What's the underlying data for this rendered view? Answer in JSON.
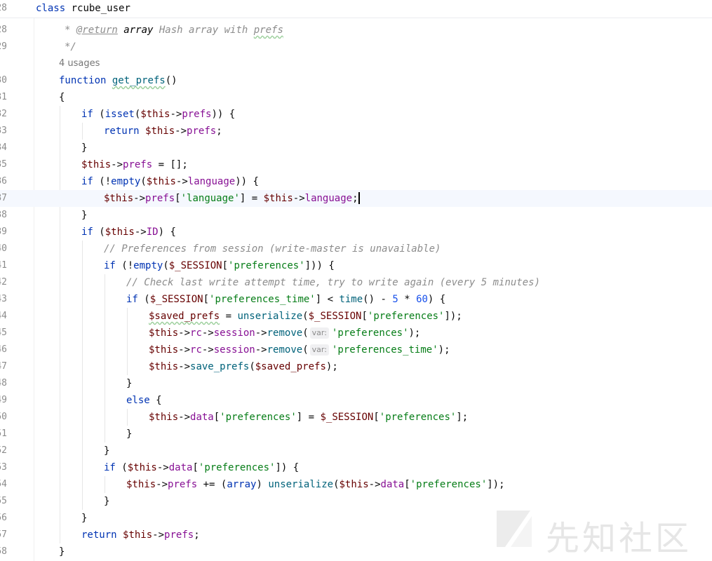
{
  "header": {
    "line_number": "28",
    "kw": "class",
    "name": "rcube_user"
  },
  "editor": {
    "l28": {
      "ln": "28",
      "prefix": "* ",
      "tag": "@return",
      "type": " array",
      "rest": " Hash array with ",
      "typo": "prefs"
    },
    "l29": {
      "ln": "29",
      "text": "*/"
    },
    "usages": "4 usages",
    "l30": {
      "ln": "30",
      "kw": "function",
      "sp": " ",
      "fn": "get_prefs",
      "rest": "()"
    },
    "l31": {
      "ln": "31",
      "text": "{"
    },
    "l32": {
      "ln": "32",
      "kw": "if",
      "t1": " (",
      "fn": "isset",
      "t2": "(",
      "this": "$this",
      "arrow": "->",
      "prop": "prefs",
      "t3": ")) {"
    },
    "l33": {
      "ln": "33",
      "kw": "return",
      "sp": " ",
      "this": "$this",
      "arrow": "->",
      "prop": "prefs",
      "t1": ";"
    },
    "l34": {
      "ln": "34",
      "text": "}"
    },
    "l35": {
      "ln": "35",
      "this": "$this",
      "arrow": "->",
      "prop": "prefs",
      "t1": " = [];"
    },
    "l36": {
      "ln": "36",
      "kw": "if",
      "t1": " (!",
      "fn": "empty",
      "t2": "(",
      "this": "$this",
      "arrow": "->",
      "prop": "language",
      "t3": ")) {"
    },
    "l37": {
      "ln": "37",
      "this1": "$this",
      "arrow1": "->",
      "prop1": "prefs",
      "t1": "[",
      "str": "'language'",
      "t2": "] = ",
      "this2": "$this",
      "arrow2": "->",
      "prop2": "language",
      "t3": ";"
    },
    "l38": {
      "ln": "38",
      "text": "}"
    },
    "l39": {
      "ln": "39",
      "kw": "if",
      "t1": " (",
      "this": "$this",
      "arrow": "->",
      "prop": "ID",
      "t2": ") {"
    },
    "l40": {
      "ln": "40",
      "comment": "// Preferences from session (write-master is unavailable)"
    },
    "l41": {
      "ln": "41",
      "kw": "if",
      "t1": " (!",
      "fn": "empty",
      "t2": "(",
      "sess": "$_SESSION",
      "t3": "[",
      "str": "'preferences'",
      "t4": "])) {"
    },
    "l42": {
      "ln": "42",
      "comment": "// Check last write attempt time, try to write again (every 5 minutes)"
    },
    "l43": {
      "ln": "43",
      "kw": "if",
      "t1": " (",
      "sess": "$_SESSION",
      "t2": "[",
      "str": "'preferences_time'",
      "t3": "] < ",
      "fn": "time",
      "t4": "() - ",
      "n1": "5",
      "t5": " * ",
      "n2": "60",
      "t6": ") {"
    },
    "l44": {
      "ln": "44",
      "var": "$saved_prefs",
      "t1": " = ",
      "fn": "unserialize",
      "t2": "(",
      "sess": "$_SESSION",
      "t3": "[",
      "str": "'preferences'",
      "t4": "]);"
    },
    "l45": {
      "ln": "45",
      "this": "$this",
      "a1": "->",
      "p1": "rc",
      "a2": "->",
      "p2": "session",
      "a3": "->",
      "fn": "remove",
      "t1": "(",
      "hint": "var:",
      "str": "'preferences'",
      "t2": ");"
    },
    "l46": {
      "ln": "46",
      "this": "$this",
      "a1": "->",
      "p1": "rc",
      "a2": "->",
      "p2": "session",
      "a3": "->",
      "fn": "remove",
      "t1": "(",
      "hint": "var:",
      "str": "'preferences_time'",
      "t2": ");"
    },
    "l47": {
      "ln": "47",
      "this": "$this",
      "a1": "->",
      "fn": "save_prefs",
      "t1": "(",
      "var": "$saved_prefs",
      "t2": ");"
    },
    "l48": {
      "ln": "48",
      "text": "}"
    },
    "l49": {
      "ln": "49",
      "kw": "else",
      "t1": " {"
    },
    "l50": {
      "ln": "50",
      "this": "$this",
      "arrow": "->",
      "prop": "data",
      "t1": "[",
      "str1": "'preferences'",
      "t2": "] = ",
      "sess": "$_SESSION",
      "t3": "[",
      "str2": "'preferences'",
      "t4": "];"
    },
    "l51": {
      "ln": "51",
      "text": "}"
    },
    "l52": {
      "ln": "52",
      "text": "}"
    },
    "l53": {
      "ln": "53",
      "kw": "if",
      "t1": " (",
      "this": "$this",
      "arrow": "->",
      "prop": "data",
      "t2": "[",
      "str": "'preferences'",
      "t3": "]) {"
    },
    "l54": {
      "ln": "54",
      "this1": "$this",
      "arrow1": "->",
      "prop1": "prefs",
      "t1": " += (",
      "kw": "array",
      "t2": ") ",
      "fn": "unserialize",
      "t3": "(",
      "this2": "$this",
      "arrow2": "->",
      "prop2": "data",
      "t4": "[",
      "str": "'preferences'",
      "t5": "]);"
    },
    "l55": {
      "ln": "55",
      "text": "}"
    },
    "l56": {
      "ln": "56",
      "text": "}"
    },
    "l57": {
      "ln": "57",
      "kw": "return",
      "sp": " ",
      "this": "$this",
      "arrow": "->",
      "prop": "prefs",
      "t1": ";"
    },
    "l58": {
      "ln": "58",
      "text": "}"
    }
  },
  "watermark": {
    "text": "先知社区"
  },
  "colors": {
    "keyword": "#0033b3",
    "function": "#00627a",
    "property": "#871094",
    "this": "#660000",
    "string": "#067d17",
    "number": "#1750eb",
    "comment": "#8c8c8c",
    "current_line": "#f5f8fe"
  }
}
